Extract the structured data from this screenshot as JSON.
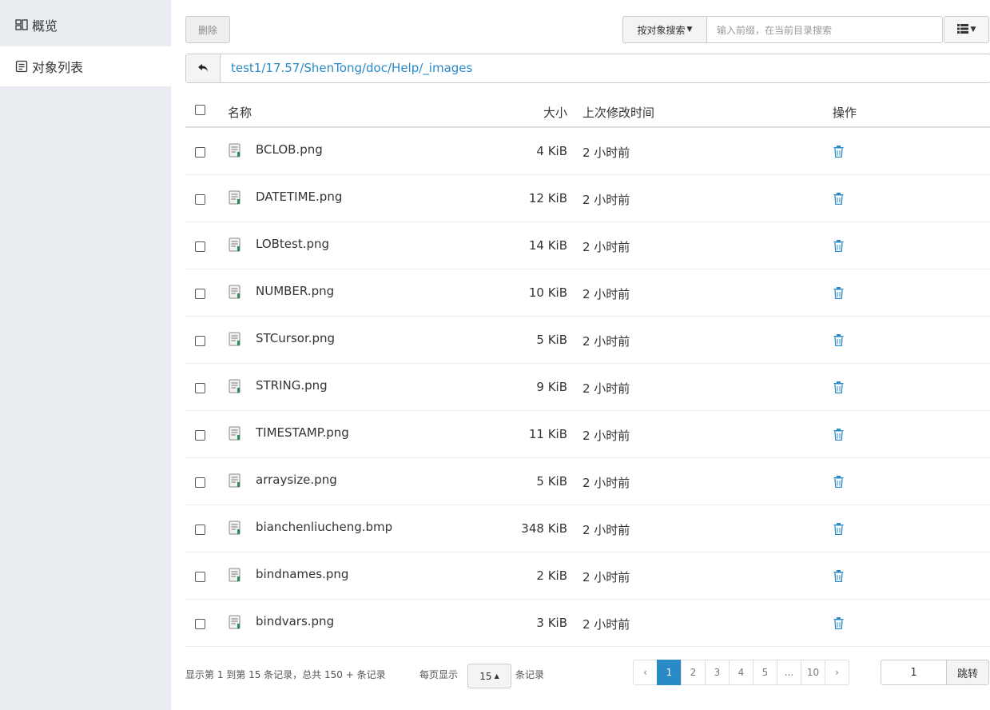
{
  "sidebar": {
    "items": [
      {
        "label": "概览",
        "icon": "overview-icon"
      },
      {
        "label": "对象列表",
        "icon": "list-icon"
      }
    ]
  },
  "toolbar": {
    "delete_label": "删除",
    "search_by_label": "按对象搜索",
    "search_placeholder": "输入前缀，在当前目录搜索",
    "view_icon": "list-view-icon"
  },
  "path": {
    "current": "test1/17.57/ShenTong/doc/Help/_images"
  },
  "table": {
    "headers": {
      "name": "名称",
      "size": "大小",
      "modified": "上次修改时间",
      "action": "操作"
    },
    "rows": [
      {
        "name": "BCLOB.png",
        "size": "4 KiB",
        "modified": "2 小时前"
      },
      {
        "name": "DATETIME.png",
        "size": "12 KiB",
        "modified": "2 小时前"
      },
      {
        "name": "LOBtest.png",
        "size": "14 KiB",
        "modified": "2 小时前"
      },
      {
        "name": "NUMBER.png",
        "size": "10 KiB",
        "modified": "2 小时前"
      },
      {
        "name": "STCursor.png",
        "size": "5 KiB",
        "modified": "2 小时前"
      },
      {
        "name": "STRING.png",
        "size": "9 KiB",
        "modified": "2 小时前"
      },
      {
        "name": "TIMESTAMP.png",
        "size": "11 KiB",
        "modified": "2 小时前"
      },
      {
        "name": "arraysize.png",
        "size": "5 KiB",
        "modified": "2 小时前"
      },
      {
        "name": "bianchenliucheng.bmp",
        "size": "348 KiB",
        "modified": "2 小时前"
      },
      {
        "name": "bindnames.png",
        "size": "2 KiB",
        "modified": "2 小时前"
      },
      {
        "name": "bindvars.png",
        "size": "3 KiB",
        "modified": "2 小时前"
      }
    ]
  },
  "footer": {
    "summary": "显示第 1 到第 15 条记录，总共 150 + 条记录",
    "per_page_prefix": "每页显示",
    "per_page_value": "15",
    "per_page_suffix": "条记录",
    "pages": [
      "‹",
      "1",
      "2",
      "3",
      "4",
      "5",
      "...",
      "10",
      "›"
    ],
    "active_page": "1",
    "jump_value": "1",
    "jump_label": "跳转"
  },
  "colors": {
    "accent": "#2a8ac7",
    "sidebar_bg": "#e9ecf0"
  }
}
